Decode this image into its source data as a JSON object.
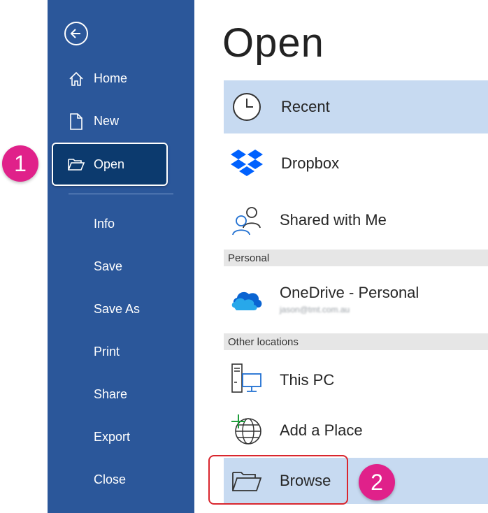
{
  "sidebar": {
    "back_label": "Back",
    "items": [
      {
        "label": "Home",
        "icon": "home-icon"
      },
      {
        "label": "New",
        "icon": "new-document-icon"
      },
      {
        "label": "Open",
        "icon": "open-folder-icon"
      },
      {
        "label": "Info"
      },
      {
        "label": "Save"
      },
      {
        "label": "Save As"
      },
      {
        "label": "Print"
      },
      {
        "label": "Share"
      },
      {
        "label": "Export"
      },
      {
        "label": "Close"
      }
    ]
  },
  "badges": {
    "one": "1",
    "two": "2"
  },
  "main": {
    "title": "Open",
    "locations": [
      {
        "label": "Recent",
        "icon": "clock-icon"
      },
      {
        "label": "Dropbox",
        "icon": "dropbox-icon"
      },
      {
        "label": "Shared with Me",
        "icon": "shared-people-icon"
      }
    ],
    "section_personal": "Personal",
    "onedrive": {
      "label": "OneDrive - Personal",
      "email": "jason@tmt.com.au",
      "icon": "onedrive-cloud-icon"
    },
    "section_other": "Other locations",
    "other": [
      {
        "label": "This PC",
        "icon": "this-pc-icon"
      },
      {
        "label": "Add a Place",
        "icon": "add-place-globe-icon"
      },
      {
        "label": "Browse",
        "icon": "browse-folder-icon"
      }
    ]
  },
  "colors": {
    "sidebar": "#2b579a",
    "sidebar_active": "#0c3a6e",
    "selected_row": "#c7daf1",
    "badge": "#e0218a",
    "highlight_red": "#d9262e"
  }
}
